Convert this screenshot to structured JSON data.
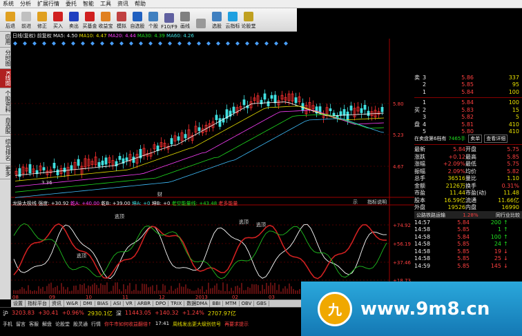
{
  "menu": [
    "系统",
    "分析",
    "扩展行情",
    "委托",
    "智能",
    "工具",
    "资讯",
    "帮助"
  ],
  "toolbar": [
    {
      "label": "后退",
      "icon": "back-arrow-icon",
      "color": "#e0a020"
    },
    {
      "label": "前进",
      "icon": "forward-arrow-icon",
      "color": "#c0c0c0"
    },
    {
      "label": "修正",
      "icon": "refresh-icon",
      "color": "#e0a020"
    },
    {
      "label": "买入",
      "icon": "buy-icon",
      "color": "#d02020"
    },
    {
      "label": "卖出",
      "icon": "sell-icon",
      "color": "#2040c0"
    },
    {
      "label": "买基金",
      "icon": "fund-buy-icon",
      "color": "#d02020"
    },
    {
      "label": "收益宝",
      "icon": "earn-icon",
      "color": "#e08020"
    },
    {
      "label": "模拟",
      "icon": "simulate-icon",
      "color": "#c04040"
    },
    {
      "label": "自选股",
      "icon": "watchlist-icon",
      "color": "#2060c0"
    },
    {
      "label": "个股",
      "icon": "stock-icon",
      "color": "#4080c0"
    },
    {
      "label": "F10/F9",
      "icon": "f10-icon",
      "color": "#6060a0"
    },
    {
      "label": "画线",
      "icon": "draw-icon",
      "color": "#808080"
    },
    {
      "label": "",
      "icon": "blank-icon",
      "color": "#999"
    },
    {
      "label": "选股",
      "icon": "select-stock-icon",
      "color": "#4080c0"
    },
    {
      "label": "云指标",
      "icon": "cloud-index-icon",
      "color": "#20a0e0"
    },
    {
      "label": "论股堂",
      "icon": "forum-icon",
      "color": "#c0a020"
    }
  ],
  "left_tabs": [
    "应用",
    "分时图",
    "K线图",
    "个股资料",
    "自选股",
    "综合排名",
    "更多"
  ],
  "active_tab": "K线图",
  "kline_header": {
    "period": "日线(复权)",
    "type": "前复权",
    "ma5": "MA5: 4.50",
    "ma10": "MA10: 4.47",
    "ma20": "MA20: 4.44",
    "ma30": "MA30: 4.39",
    "ma60": "MA60: 4.26"
  },
  "price_axis": [
    "5.80",
    "5.23",
    "4.67"
  ],
  "low_label": "3.36",
  "cai_label": "财",
  "indicator_header": {
    "name": "龙脉太极线",
    "strength": "强度: +30.92",
    "buy": "乾A: +40.00",
    "buy2": "乾B: +39.00",
    "kun": "坤A: +0",
    "kun2": "坤B: +0",
    "a": "老空能量线: +43.48",
    "b": "老多能量"
  },
  "indicator_right": [
    "示",
    "指标说明"
  ],
  "indicator_axis": [
    "+74.92",
    "+56.19",
    "+37.46",
    "+18.73"
  ],
  "indicator_labels": [
    "逃顶",
    "逃顶",
    "逃顶",
    "逃顶"
  ],
  "date_axis": [
    "08",
    "09",
    "10",
    "11",
    "12",
    "2013",
    "02",
    "03",
    "04"
  ],
  "bottom_tabs": [
    "设置",
    "指标平台",
    "资讯",
    "W&R",
    "DMI",
    "BIAS",
    "ASI",
    "VR",
    "ARBR",
    "DPO",
    "TRIX",
    "数据DMA",
    "BBI",
    "MTM",
    "OBV",
    "GBS"
  ],
  "order_book": {
    "sell": [
      [
        "3",
        "5.86",
        "337"
      ],
      [
        "2",
        "5.85",
        "95"
      ],
      [
        "1",
        "5.84",
        "100"
      ]
    ],
    "sell_label": "卖",
    "buy_label": "买盘",
    "buy": [
      [
        "1",
        "5.84",
        "100"
      ],
      [
        "2",
        "5.83",
        "15"
      ],
      [
        "3",
        "5.82",
        "5"
      ],
      [
        "4",
        "5.81",
        "410"
      ],
      [
        "5",
        "5.80",
        "410"
      ]
    ],
    "note": "在卖盘第6档有",
    "note_val": "7465手",
    "btn1": "卖单",
    "btn2": "查看详细"
  },
  "stats": [
    [
      "最新",
      "5.84",
      "开盘",
      "5.75"
    ],
    [
      "涨跌",
      "+0.12",
      "最高",
      "5.85"
    ],
    [
      "涨幅",
      "+2.09%",
      "最低",
      "5.75"
    ],
    [
      "振幅",
      "2.09%",
      "均价",
      "5.82"
    ],
    [
      "总手",
      "36516",
      "量比",
      "1.10"
    ],
    [
      "金额",
      "2126万",
      "换手",
      "0.31%"
    ],
    [
      "市盈",
      "11.44",
      "市盈(动)",
      "11.48"
    ],
    [
      "股本",
      "16.59亿",
      "流通",
      "11.66亿"
    ],
    [
      "外盘",
      "19526",
      "内盘",
      "16990"
    ]
  ],
  "sector": {
    "name": "公路铁路运输",
    "pct": "1.28%",
    "link": "同行业比较"
  },
  "ticks": [
    [
      "14:57",
      "5.84",
      "200",
      "up"
    ],
    [
      "14:58",
      "5.85",
      "1",
      "up"
    ],
    [
      "14:58",
      "5.84",
      "100",
      "up"
    ],
    [
      "14:58",
      "5.85",
      "24",
      "up"
    ],
    [
      "14:58",
      "5.85",
      "19",
      "down"
    ],
    [
      "14:58",
      "5.85",
      "25",
      "down"
    ],
    [
      "14:59",
      "5.85",
      "145",
      "down"
    ]
  ],
  "status": {
    "row1": [
      {
        "t": "沪",
        "c": "#eee"
      },
      {
        "t": "3203.83",
        "c": "#ff4040"
      },
      {
        "t": "+30.41",
        "c": "#ff4040"
      },
      {
        "t": "+0.96%",
        "c": "#ff4040"
      },
      {
        "t": "2930.1亿",
        "c": "#e8e000"
      },
      {
        "t": "深",
        "c": "#eee"
      },
      {
        "t": "11443.05",
        "c": "#ff4040"
      },
      {
        "t": "+140.32",
        "c": "#ff4040"
      },
      {
        "t": "+1.24%",
        "c": "#ff4040"
      },
      {
        "t": "2707.97亿",
        "c": "#e8e000"
      }
    ],
    "row2": [
      {
        "t": "手机",
        "c": "#ddd"
      },
      {
        "t": "留言",
        "c": "#ddd"
      },
      {
        "t": "客服",
        "c": "#ddd"
      },
      {
        "t": "解盘",
        "c": "#ddd"
      },
      {
        "t": "论股堂",
        "c": "#ddd"
      },
      {
        "t": "股灵通",
        "c": "#ddd"
      },
      {
        "t": "行情",
        "c": "#ddd"
      },
      {
        "t": "你牛市如何收益翻倍↑",
        "c": "#ff4040"
      },
      {
        "t": "17:41",
        "c": "#eee"
      },
      {
        "t": "周线发出更大级别信号",
        "c": "#e8e000"
      },
      {
        "t": "再要求提示",
        "c": "#ff4040"
      }
    ]
  },
  "watermark": {
    "text": "www.9m8.cn",
    "logo": "九"
  }
}
